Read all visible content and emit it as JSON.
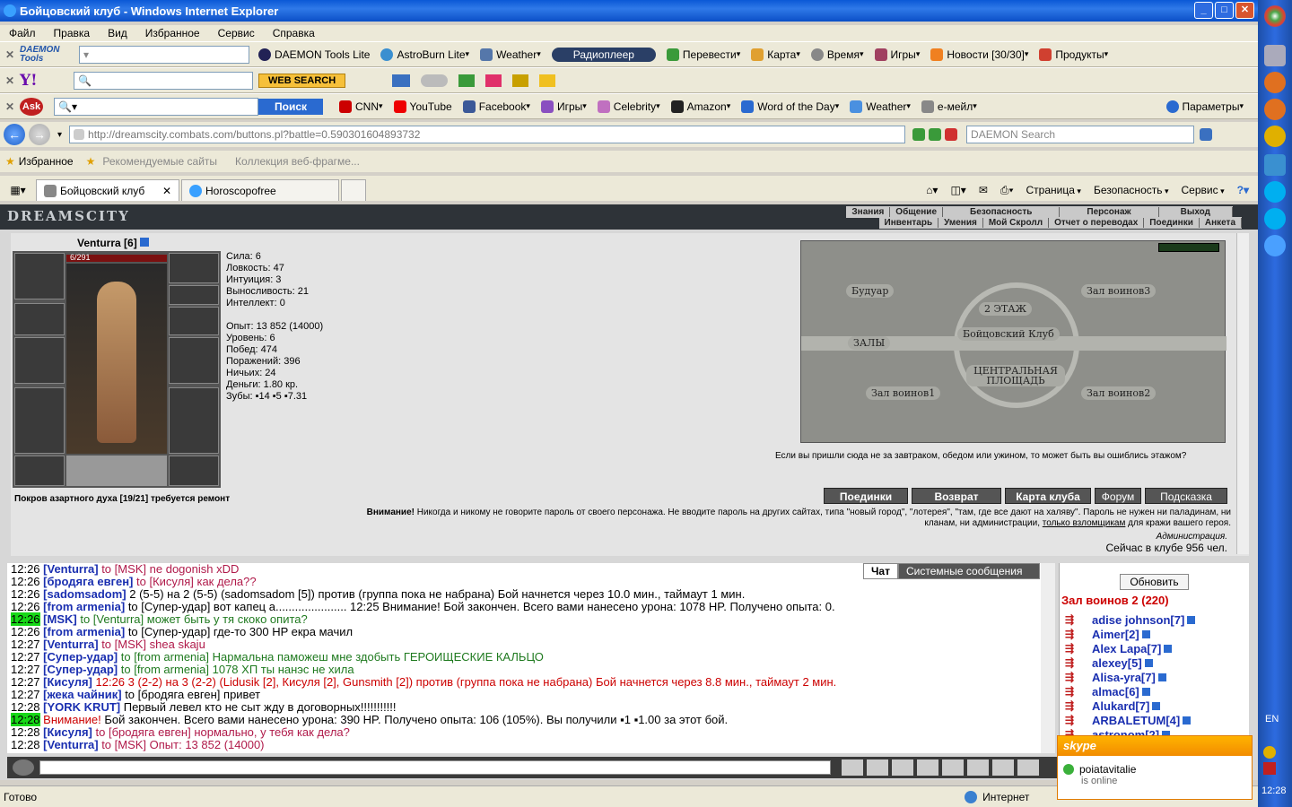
{
  "window": {
    "title": "Бойцовский клуб - Windows Internet Explorer"
  },
  "menu": [
    "Файл",
    "Правка",
    "Вид",
    "Избранное",
    "Сервис",
    "Справка"
  ],
  "toolbar1": {
    "brand": "DAEMON Tools",
    "items": [
      "DAEMON Tools Lite",
      "AstroBurn Lite",
      "Weather",
      "Радиоплеер",
      "Перевести",
      "Карта",
      "Время",
      "Игры",
      "Новости [30/30]",
      "Продукты"
    ]
  },
  "toolbar2": {
    "brand": "Y!",
    "web_search": "WEB SEARCH"
  },
  "toolbar3": {
    "brand": "Ask",
    "search_btn": "Поиск",
    "items": [
      "CNN",
      "YouTube",
      "Facebook",
      "Игры",
      "Celebrity",
      "Amazon",
      "Word of the Day",
      "Weather",
      "e-мейл"
    ],
    "params": "Параметры"
  },
  "address": {
    "url": "http://dreamscity.combats.com/buttons.pl?battle=0.590301604893732",
    "search_placeholder": "DAEMON Search"
  },
  "favorites": {
    "label": "Избранное",
    "items": [
      "Рекомендуемые сайты",
      "Коллекция веб-фрагме..."
    ]
  },
  "tabs": [
    {
      "label": "Бойцовский клуб"
    },
    {
      "label": "Horoscopofree"
    }
  ],
  "cmdbar": {
    "items": [
      "Страница",
      "Безопасность",
      "Сервис"
    ]
  },
  "game": {
    "logo": "DREAMSCITY",
    "nav_top": [
      "Знания",
      "Общение",
      "Безопасность",
      "Персонаж",
      "Выход"
    ],
    "nav_bottom": [
      "Инвентарь",
      "Умения",
      "Мой Скролл",
      "Отчет о переводах",
      "Поединки",
      "Анкета"
    ],
    "char_name": "Venturra [6]",
    "hp": "6/291",
    "stats": [
      "Сила: 6",
      "Ловкость: 47",
      "Интуиция: 3",
      "Выносливость: 21",
      "Интеллект: 0"
    ],
    "stats2": [
      "Опыт: 13 852 (14000)",
      "Уровень: 6",
      "Побед: 474",
      "Поражений: 396",
      "Ничьих: 24",
      "Деньги: 1.80 кр.",
      "Зубы: ▪14 ▪5 ▪7.31"
    ],
    "item_note": "Покров азартного духа [19/21] требуется ремонт",
    "map_labels": [
      "Будуар",
      "Зал воинов3",
      "2 ЭТАЖ",
      "Бойцовский Клуб",
      "ЗАЛЫ",
      "ЦЕНТРАЛЬНАЯ ПЛОЩАДЬ",
      "Зал воинов1",
      "Зал воинов2"
    ],
    "map_note": "Если вы пришли сюда не за завтраком, обедом или ужином, то может быть вы ошиблись этажом?",
    "buttons": [
      "Поединки",
      "Возврат",
      "Карта клуба",
      "Форум",
      "Подсказка"
    ],
    "warning_bold": "Внимание!",
    "warning": "Никогда и никому не говорите пароль от своего персонажа. Не вводите пароль на других сайтах, типа \"новый город\", \"лотерея\", \"там, где все дают на халяву\". Пароль не нужен ни паладинам, ни кланам, ни администрации,",
    "warning_link": "только взломщикам",
    "warning_end": "для кражи вашего героя.",
    "admin": "Администрация.",
    "online": "Сейчас в клубе 956 чел."
  },
  "chat_tabs": [
    "Чат",
    "Системные сообщения"
  ],
  "chat": [
    {
      "t": "12:26",
      "n": "[Venturra]",
      "rest": " to [MSK] ne dogonish xDD",
      "c": "purple"
    },
    {
      "t": "12:26",
      "n": "[бродяга евген]",
      "rest": " to [Кисуля] как дела??",
      "c": "purple"
    },
    {
      "t": "12:26",
      "n": "[sadomsadom]",
      "rest": " 2 (5-5) на 2 (5-5) (sadomsadom [5]) против (группа пока не набрана) Бой начнется через 10.0 мин., таймаут 1 мин.",
      "c": "t"
    },
    {
      "t": "12:26",
      "n": "[from armenia]",
      "rest": " to [Супер-удар] вот капец а...................... 12:25 Внимание! Бой закончен. Всего вами нанесено урона: 1078 HP. Получено опыта: 0.",
      "c": "t"
    },
    {
      "t": "12:26",
      "n": "[MSK]",
      "rest": " to [Venturra] может быть у тя скоко опита?",
      "c": "green",
      "hl": true
    },
    {
      "t": "12:26",
      "n": "[from armenia]",
      "rest": " to [Супер-удар] где-то 300 HP екра мачил",
      "c": "t"
    },
    {
      "t": "12:27",
      "n": "[Venturra]",
      "rest": " to [MSK] shea skaju",
      "c": "purple"
    },
    {
      "t": "12:27",
      "n": "[Супер-удар]",
      "rest": " to [from armenia] Нармальна паможеш мне здобыть ГЕРОИЩЕСКИЕ КАЛЬЦО",
      "c": "green"
    },
    {
      "t": "12:27",
      "n": "[Супер-удар]",
      "rest": " to [from armenia] 1078 ХП ты нанэс не хила",
      "c": "green"
    },
    {
      "t": "12:27",
      "n": "[Кисуля]",
      "rest": " 12:26 3 (2-2) на 3 (2-2) (Lidusik [2], Кисуля [2], Gunsmith [2]) против (группа пока не набрана) Бой начнется через 8.8 мин., таймаут 2 мин.",
      "c": "red"
    },
    {
      "t": "12:27",
      "n": "[жека чайник]",
      "rest": " to [бродяга евген] привет",
      "c": "t"
    },
    {
      "t": "12:28",
      "n": "[YORK KRUT]",
      "rest": " Первый левел кто не сыт жду в договорных!!!!!!!!!!!",
      "c": "t"
    },
    {
      "t": "12:28",
      "n": "Внимание!",
      "rest": " Бой закончен. Всего вами нанесено урона: 390 HP. Получено опыта: 106 (105%). Вы получили ▪1 ▪1.00 за этот бой.",
      "c": "t",
      "hl": true,
      "sys": true
    },
    {
      "t": "12:28",
      "n": "[Кисуля]",
      "rest": " to [бродяга евген] нормально, у тебя как дела?",
      "c": "purple"
    },
    {
      "t": "12:28",
      "n": "[Venturra]",
      "rest": " to [MSK] Опыт: 13 852 (14000)",
      "c": "purple"
    }
  ],
  "room": {
    "refresh": "Обновить",
    "title": "Зал воинов 2 (220)",
    "users": [
      "adise johnson[7]",
      "Aimer[2]",
      "Alex Lapa[7]",
      "alexey[5]",
      "Alisa-yra[7]",
      "almac[6]",
      "Alukard[7]",
      "ARBALETUM[4]",
      "astronom[2]"
    ]
  },
  "skype": {
    "brand": "skype",
    "user": "poiatavitalie",
    "status": "is online"
  },
  "status": {
    "left": "Готово",
    "zone": "Интернет"
  },
  "taskbar": {
    "lang": "EN",
    "clock": "12:28"
  }
}
